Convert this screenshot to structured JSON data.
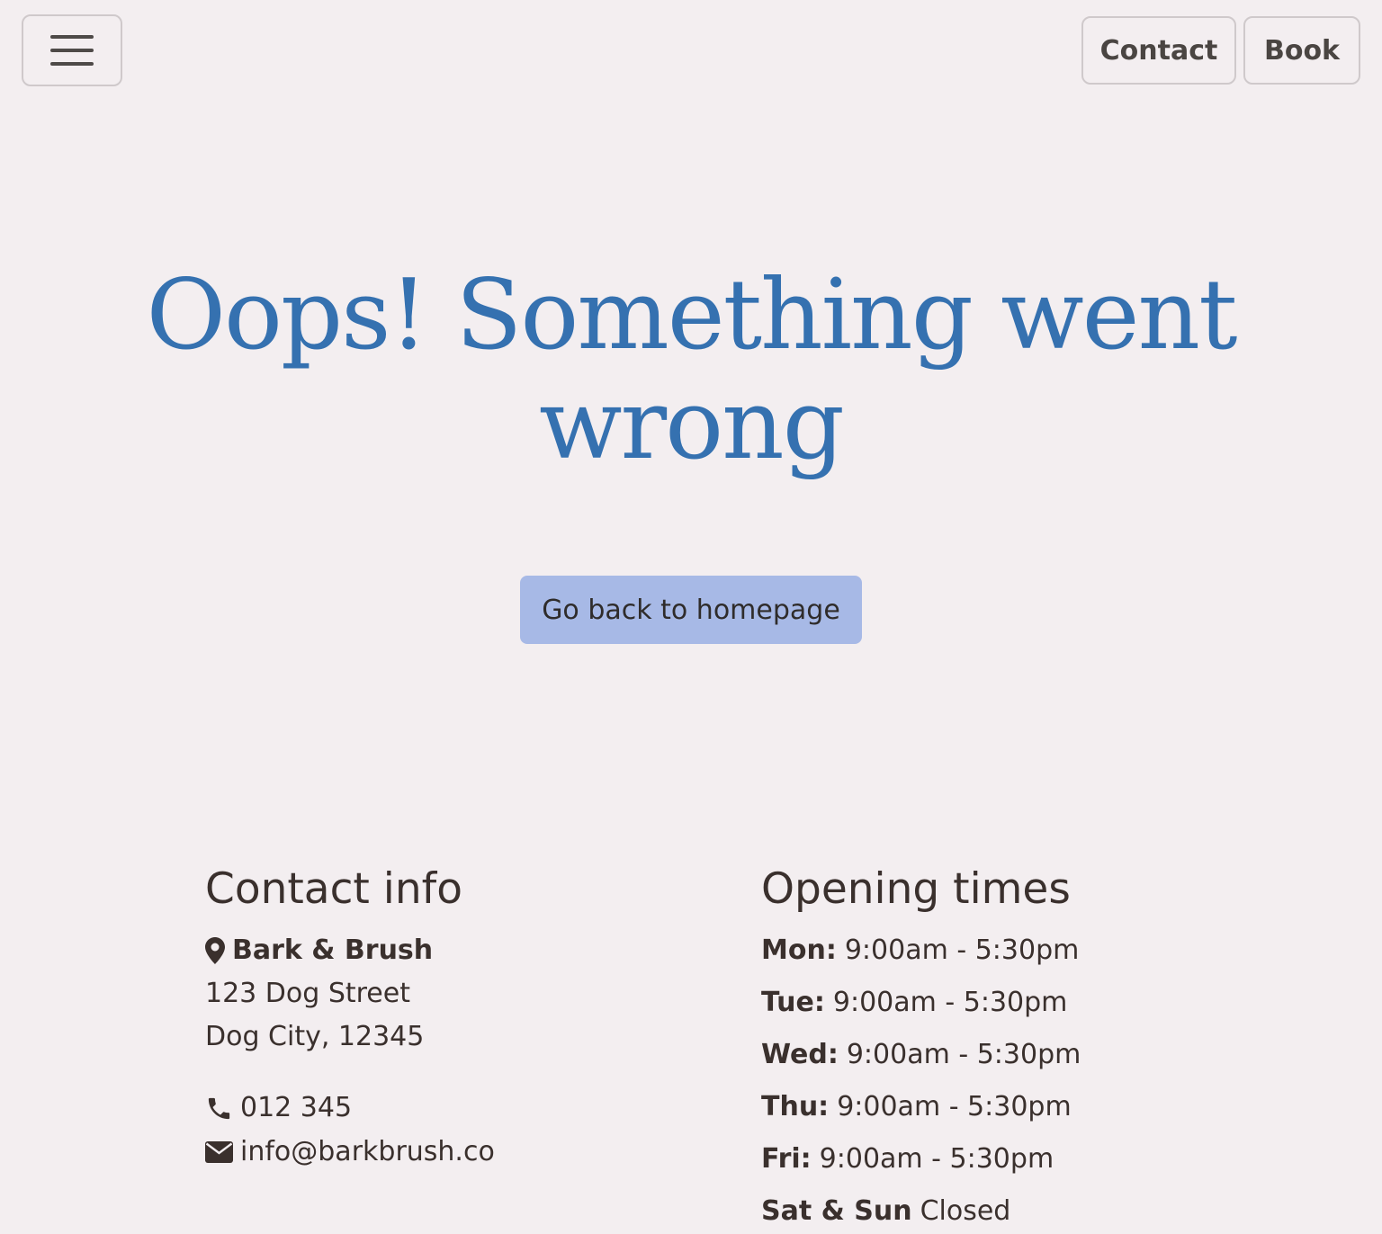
{
  "header": {
    "contact_label": "Contact",
    "book_label": "Book"
  },
  "hero": {
    "title": "Oops! Something went wrong",
    "cta_label": "Go back to homepage"
  },
  "footer": {
    "contact": {
      "title": "Contact info",
      "business_name": "Bark & Brush",
      "address_line1": "123 Dog Street",
      "address_line2": "Dog City, 12345",
      "phone": "012 345",
      "email": "info@barkbrush.co"
    },
    "hours": {
      "title": "Opening times",
      "days": [
        {
          "day": "Mon:",
          "time": "9:00am - 5:30pm"
        },
        {
          "day": "Tue:",
          "time": "9:00am - 5:30pm"
        },
        {
          "day": "Wed:",
          "time": "9:00am - 5:30pm"
        },
        {
          "day": "Thu:",
          "time": "9:00am - 5:30pm"
        },
        {
          "day": "Fri:",
          "time": "9:00am - 5:30pm"
        },
        {
          "day": "Sat & Sun",
          "time": "Closed"
        }
      ]
    }
  },
  "colors": {
    "background": "#f3eef0",
    "heading": "#3571b0",
    "cta_background": "#a7b9e6",
    "text": "#3a302d"
  },
  "icons": [
    "menu-icon",
    "map-pin-icon",
    "phone-icon",
    "envelope-icon"
  ]
}
